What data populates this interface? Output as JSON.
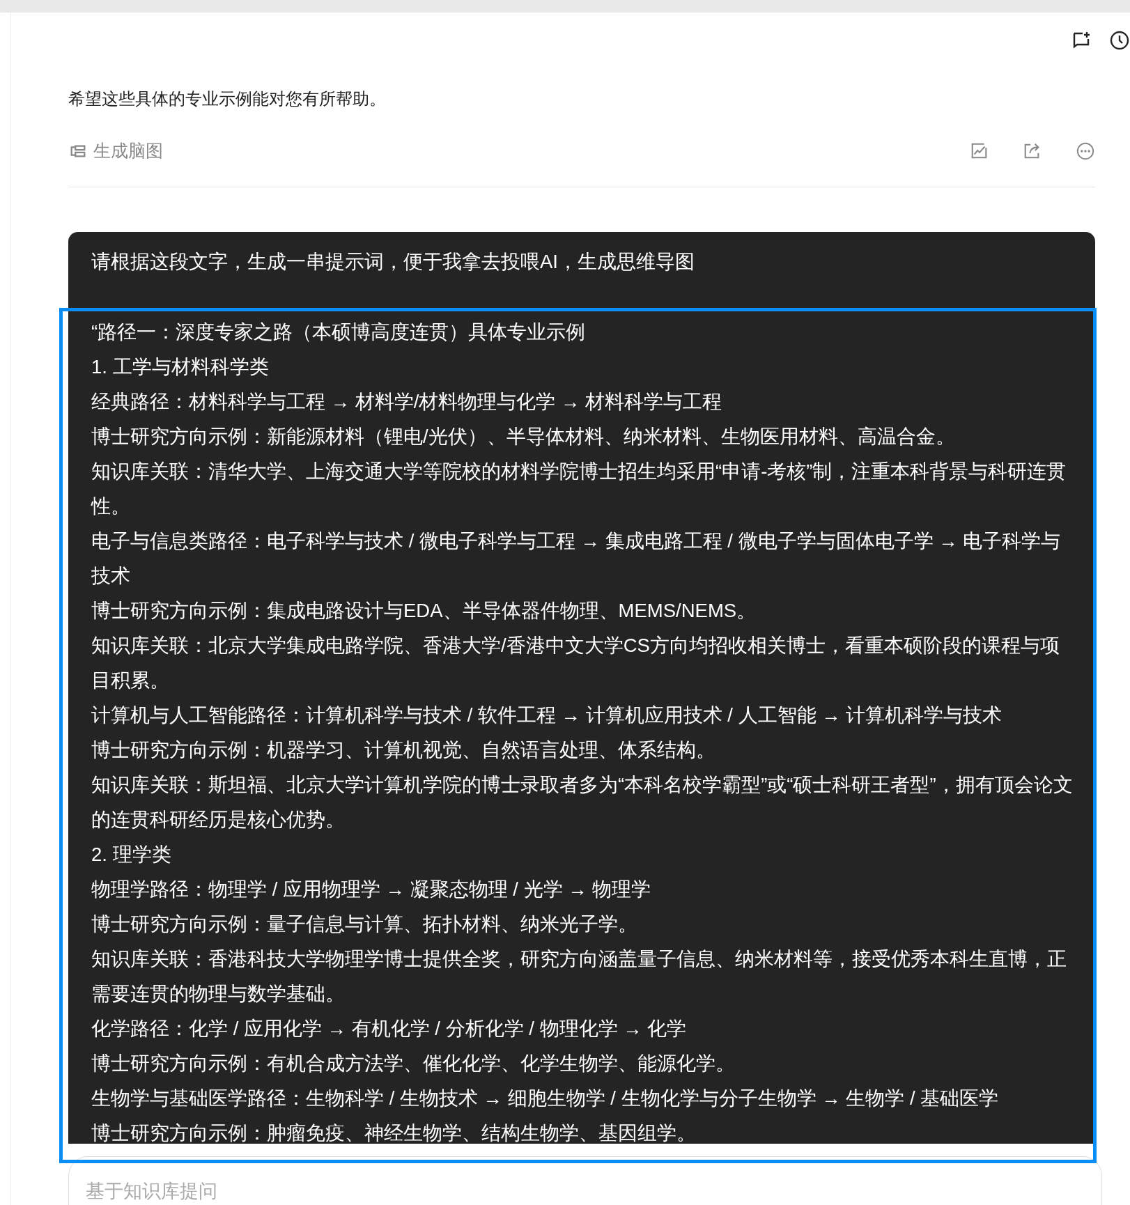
{
  "header_icons": [
    {
      "kind": "new-note"
    },
    {
      "kind": "history"
    }
  ],
  "answer": {
    "text": "希望这些具体的专业示例能对您有所帮助。",
    "mindmap_button": "生成脑图",
    "actions": [
      {
        "kind": "edit"
      },
      {
        "kind": "share"
      },
      {
        "kind": "more"
      }
    ]
  },
  "user_message": {
    "title": "请根据这段文字，生成一串提示词，便于我拿去投喂AI，生成思维导图",
    "selected": true,
    "lines": [
      "“路径一：深度专家之路（本硕博高度连贯）具体专业示例",
      "1. 工学与材料科学类",
      "经典路径：材料科学与工程 → 材料学/材料物理与化学 → 材料科学与工程",
      "博士研究方向示例：新能源材料（锂电/光伏）、半导体材料、纳米材料、生物医用材料、高温合金。",
      "知识库关联：清华大学、上海交通大学等院校的材料学院博士招生均采用“申请-考核”制，注重本科背景与科研连贯性。",
      "电子与信息类路径：电子科学与技术 / 微电子科学与工程 → 集成电路工程 / 微电子学与固体电子学 → 电子科学与技术",
      "博士研究方向示例：集成电路设计与EDA、半导体器件物理、MEMS/NEMS。",
      "知识库关联：北京大学集成电路学院、香港大学/香港中文大学CS方向均招收相关博士，看重本硕阶段的课程与项目积累。",
      "计算机与人工智能路径：计算机科学与技术 / 软件工程 → 计算机应用技术 / 人工智能 → 计算机科学与技术",
      "博士研究方向示例：机器学习、计算机视觉、自然语言处理、体系结构。",
      "知识库关联：斯坦福、北京大学计算机学院的博士录取者多为“本科名校学霸型”或“硕士科研王者型”，拥有顶会论文的连贯科研经历是核心优势。",
      "2. 理学类",
      "物理学路径：物理学 / 应用物理学 → 凝聚态物理 / 光学 → 物理学",
      "博士研究方向示例：量子信息与计算、拓扑材料、纳米光子学。",
      "知识库关联：香港科技大学物理学博士提供全奖，研究方向涵盖量子信息、纳米材料等，接受优秀本科生直博，正需要连贯的物理与数学基础。",
      "化学路径：化学 / 应用化学 → 有机化学 / 分析化学 / 物理化学 → 化学",
      "博士研究方向示例：有机合成方法学、催化化学、化学生物学、能源化学。",
      "生物学与基础医学路径：生物科学 / 生物技术 → 细胞生物学 / 生物化学与分子生物学 → 生物学 / 基础医学",
      "博士研究方向示例：肿瘤免疫、神经生物学、结构生物学、基因组学。"
    ]
  },
  "input": {
    "placeholder": "基于知识库提问"
  }
}
